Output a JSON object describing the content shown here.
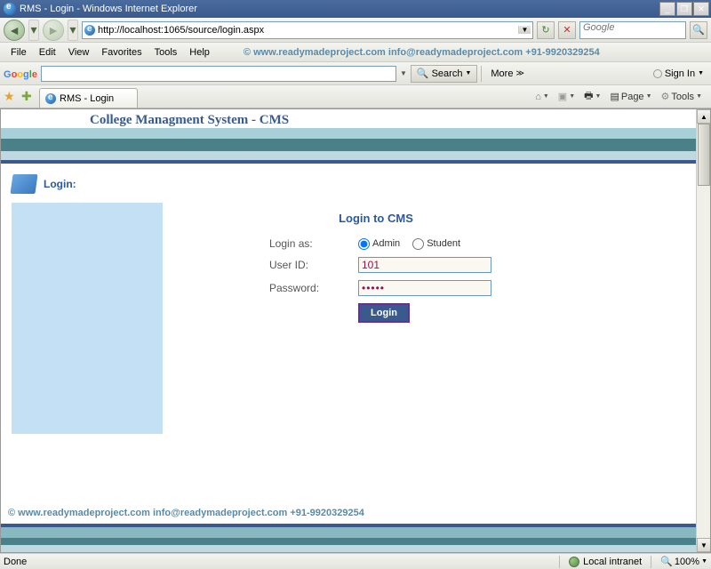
{
  "window": {
    "title": "RMS - Login - Windows Internet Explorer"
  },
  "nav": {
    "url": "http://localhost:1065/source/login.aspx",
    "search_placeholder": "Google"
  },
  "menu": {
    "file": "File",
    "edit": "Edit",
    "view": "View",
    "favorites": "Favorites",
    "tools": "Tools",
    "help": "Help"
  },
  "watermark": "©  www.readymadeproject.com  info@readymadeproject.com  +91-9920329254",
  "google_toolbar": {
    "search_btn": "Search",
    "more_btn": "More",
    "signin": "Sign In"
  },
  "tab": {
    "title": "RMS - Login"
  },
  "tab_tools": {
    "page": "Page",
    "tools": "Tools"
  },
  "page": {
    "header": "College Managment System - CMS",
    "login_section": "Login:",
    "form_title": "Login to CMS",
    "login_as_label": "Login as:",
    "admin_option": "Admin",
    "student_option": "Student",
    "userid_label": "User ID:",
    "userid_value": "101",
    "password_label": "Password:",
    "password_value": "•••••",
    "login_button": "Login"
  },
  "status": {
    "left": "Done",
    "zone": "Local intranet",
    "zoom": "100%"
  }
}
